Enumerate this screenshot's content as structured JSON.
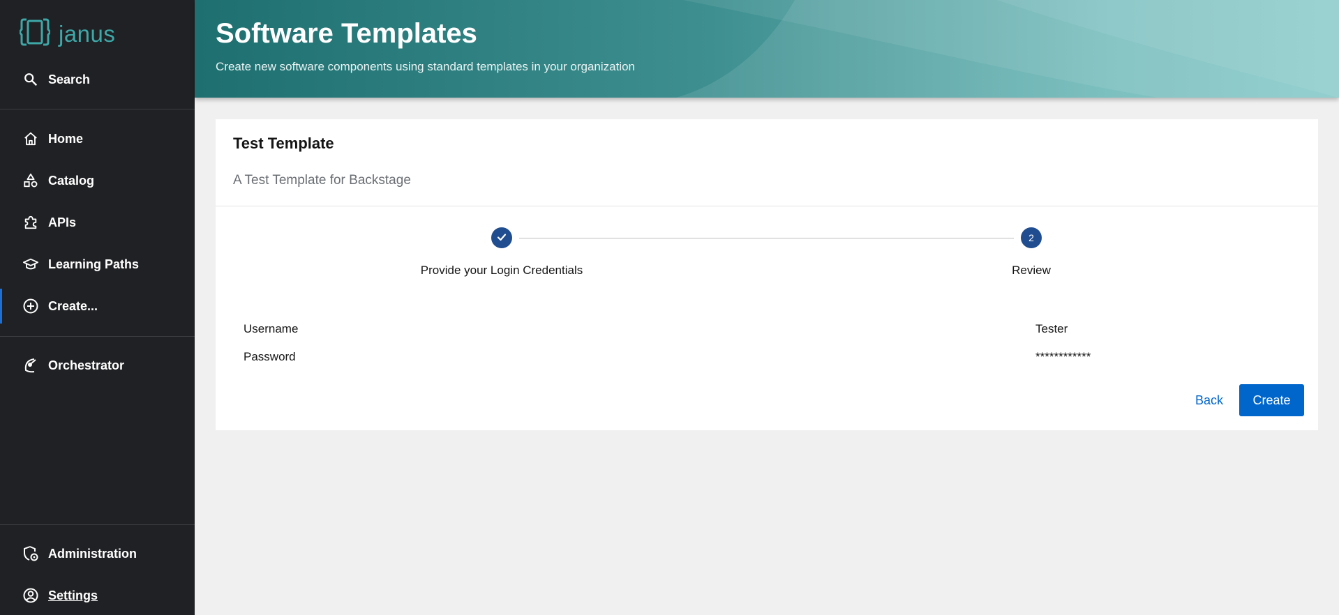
{
  "brand": {
    "name": "janus",
    "color": "#3ea8a9"
  },
  "sidebar": {
    "search": {
      "label": "Search",
      "icon": "search-icon"
    },
    "items": [
      {
        "label": "Home",
        "icon": "home-icon"
      },
      {
        "label": "Catalog",
        "icon": "catalog-icon"
      },
      {
        "label": "APIs",
        "icon": "puzzle-icon"
      },
      {
        "label": "Learning Paths",
        "icon": "graduation-cap-icon"
      },
      {
        "label": "Create...",
        "icon": "plus-circle-icon",
        "active": true
      },
      {
        "label": "Orchestrator",
        "icon": "orchestrator-icon"
      }
    ],
    "bottom": [
      {
        "label": "Administration",
        "icon": "shield-gear-icon"
      },
      {
        "label": "Settings",
        "icon": "user-circle-icon"
      }
    ]
  },
  "header": {
    "title": "Software Templates",
    "subtitle": "Create new software components using standard templates in your organization"
  },
  "template": {
    "title": "Test Template",
    "description": "A Test Template for Backstage"
  },
  "stepper": {
    "steps": [
      {
        "label": "Provide your Login Credentials",
        "status": "completed"
      },
      {
        "label": "Review",
        "number": "2",
        "status": "active"
      }
    ]
  },
  "review": {
    "rows": [
      {
        "label": "Username",
        "value": "Tester"
      },
      {
        "label": "Password",
        "value": "************"
      }
    ]
  },
  "actions": {
    "back": "Back",
    "create": "Create"
  },
  "colors": {
    "sidebar_bg": "#202124",
    "accent": "#0066cc",
    "step": "#1f4d8f",
    "active_indicator": "#1d6fd4"
  }
}
